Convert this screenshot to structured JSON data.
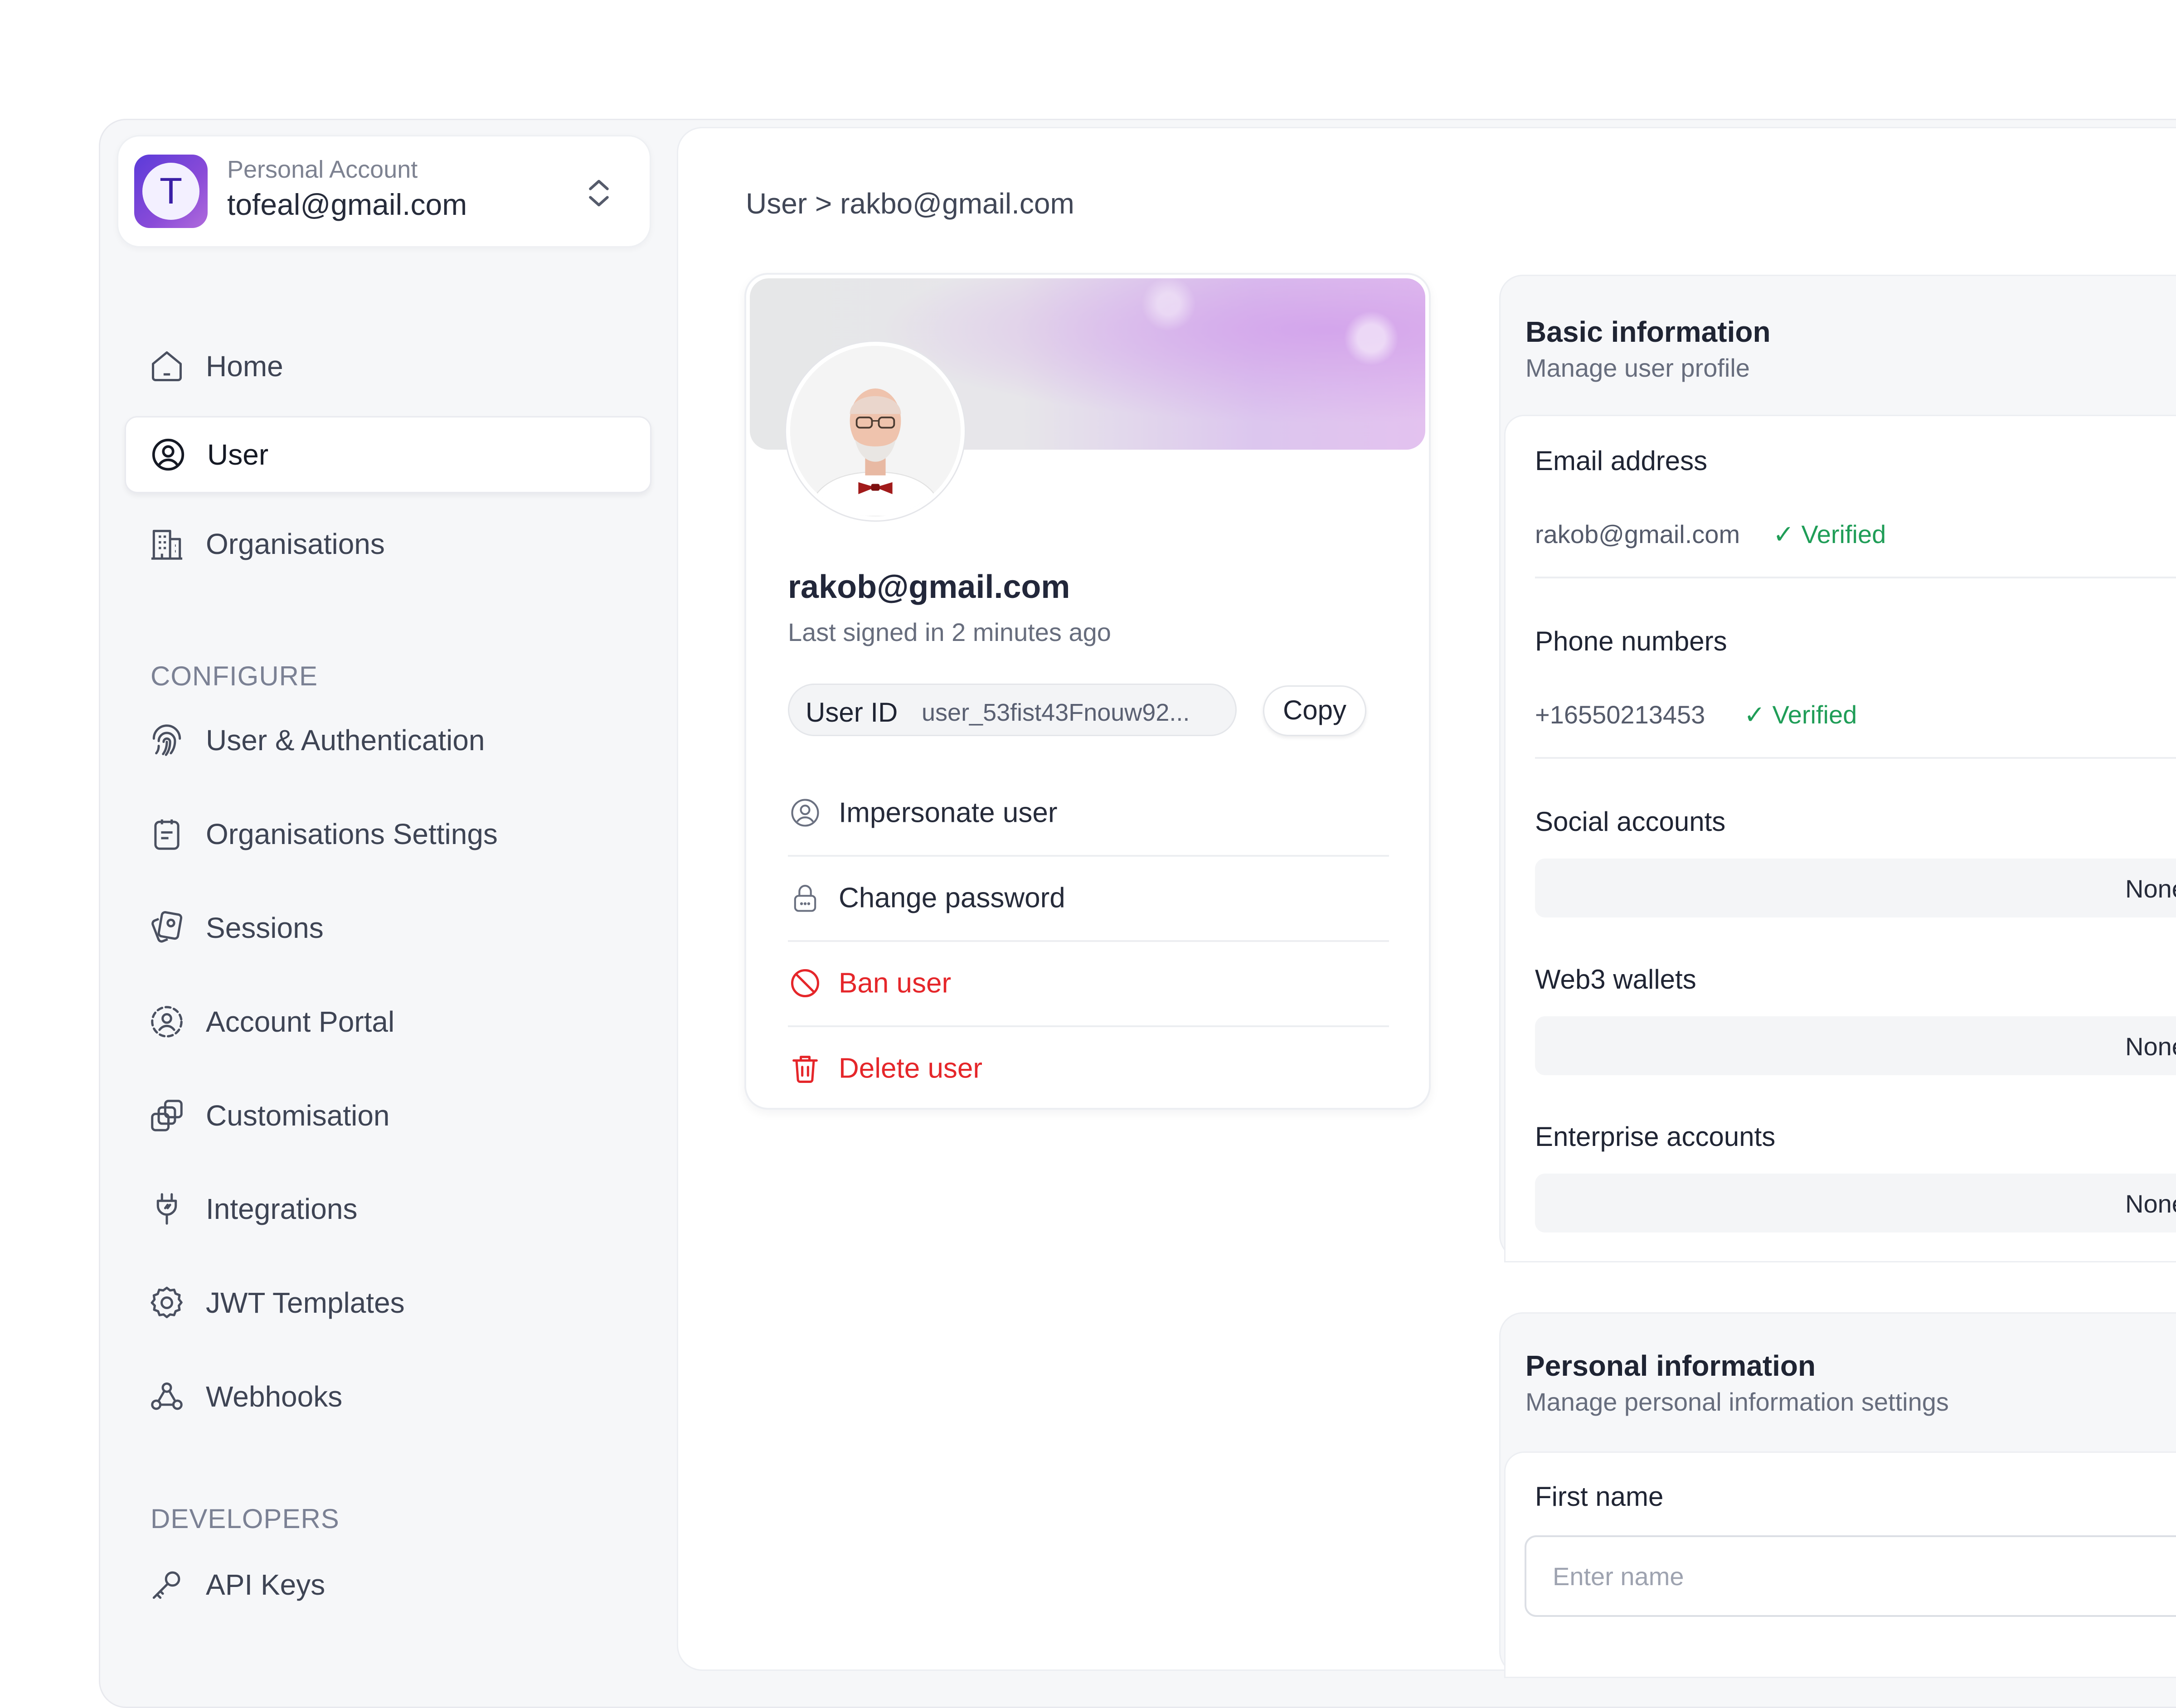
{
  "account": {
    "initial": "T",
    "label": "Personal Account",
    "email": "tofeal@gmail.com"
  },
  "sidebar": {
    "nav_items": [
      {
        "label": "Home",
        "icon": "home-icon",
        "active": false
      },
      {
        "label": "User",
        "icon": "user-circle-icon",
        "active": true
      },
      {
        "label": "Organisations",
        "icon": "building-icon",
        "active": false
      }
    ],
    "configure_heading": "CONFIGURE",
    "configure_items": [
      {
        "label": "User & Authentication",
        "icon": "fingerprint-icon"
      },
      {
        "label": "Organisations Settings",
        "icon": "clipboard-icon"
      },
      {
        "label": "Sessions",
        "icon": "cards-icon"
      },
      {
        "label": "Account Portal",
        "icon": "user-dashed-circle-icon"
      },
      {
        "label": "Customisation",
        "icon": "copy-shapes-icon"
      },
      {
        "label": "Integrations",
        "icon": "plug-icon"
      },
      {
        "label": "JWT Templates",
        "icon": "gear-icon"
      },
      {
        "label": "Webhooks",
        "icon": "webhook-icon"
      }
    ],
    "developers_heading": "DEVELOPERS",
    "developers_items": [
      {
        "label": "API Keys",
        "icon": "key-icon"
      }
    ]
  },
  "breadcrumb": {
    "parent": "User",
    "separator": ">",
    "current": "rakbo@gmail.com"
  },
  "profile": {
    "email": "rakob@gmail.com",
    "last_signed": "Last signed in 2 minutes ago",
    "user_id_label": "User ID",
    "user_id_value": "user_53fist43Fnouw92...",
    "copy_label": "Copy",
    "actions": [
      {
        "label": "Impersonate user",
        "icon": "user-circle-icon",
        "danger": false
      },
      {
        "label": "Change password",
        "icon": "lock-icon",
        "danger": false
      },
      {
        "label": "Ban user",
        "icon": "ban-icon",
        "danger": true
      },
      {
        "label": "Delete user",
        "icon": "trash-icon",
        "danger": true
      }
    ]
  },
  "basic_info": {
    "title": "Basic information",
    "subtitle": "Manage user profile",
    "email_title": "Email address",
    "email_value": "rakob@gmail.com",
    "email_status": "Verified",
    "phone_title": "Phone numbers",
    "phone_value": "+16550213453",
    "phone_status": "Verified",
    "social_title": "Social accounts",
    "social_value": "None",
    "web3_title": "Web3 wallets",
    "web3_value": "None",
    "enterprise_title": "Enterprise accounts",
    "enterprise_value": "None"
  },
  "personal_info": {
    "title": "Personal information",
    "subtitle": "Manage personal information settings",
    "first_name_label": "First name",
    "first_name_placeholder": "Enter name",
    "first_name_value": ""
  },
  "colors": {
    "accent_purple": "#5b3bd9",
    "danger": "#e5262a",
    "verified": "#1f9d57"
  }
}
